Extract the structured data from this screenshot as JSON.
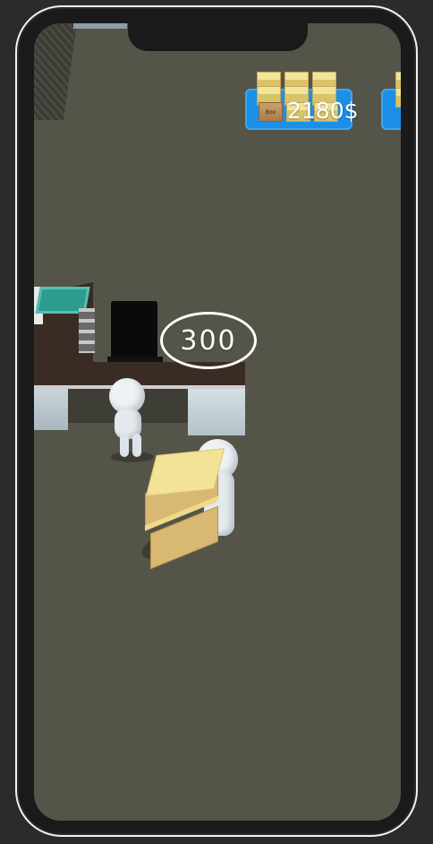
{
  "game": {
    "hud": {
      "money_text": "2180$"
    },
    "price_marker": {
      "value_text": "300"
    },
    "crate_label": "Box",
    "colors": {
      "floor": "#545449",
      "pad": "#1c8fe6",
      "box": "#f3e396",
      "desk": "#3a2c24"
    },
    "icons": [
      "phone-frame",
      "money-pad",
      "price-ring",
      "worker-figure",
      "box-stack",
      "office-desk",
      "office-chair"
    ]
  }
}
